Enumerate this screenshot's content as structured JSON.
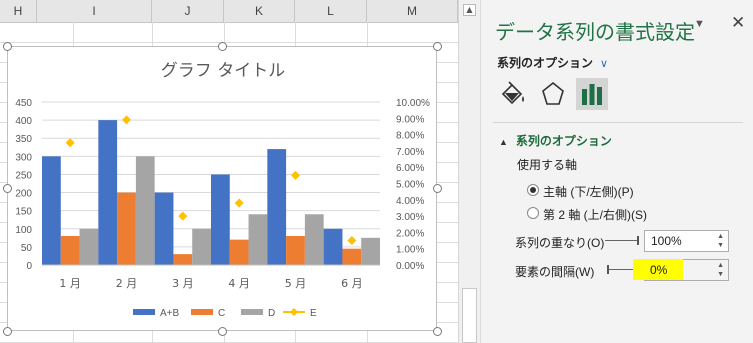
{
  "sheet": {
    "columns": [
      "H",
      "I",
      "J",
      "K",
      "L",
      "M"
    ]
  },
  "chart_data": {
    "type": "bar",
    "title": "グラフ タイトル",
    "categories": [
      "1 月",
      "2 月",
      "3 月",
      "4 月",
      "5 月",
      "6 月"
    ],
    "series": [
      {
        "name": "A+B",
        "type": "bar",
        "axis": "primary",
        "color": "#4472c4",
        "values": [
          300,
          400,
          200,
          250,
          320,
          100
        ]
      },
      {
        "name": "C",
        "type": "bar",
        "axis": "primary",
        "color": "#ed7d31",
        "values": [
          80,
          200,
          30,
          70,
          80,
          45
        ]
      },
      {
        "name": "D",
        "type": "bar",
        "axis": "primary",
        "color": "#a5a5a5",
        "values": [
          100,
          300,
          100,
          140,
          140,
          75
        ]
      },
      {
        "name": "E",
        "type": "scatter-marker",
        "axis": "secondary",
        "color": "#ffc000",
        "values": [
          0.075,
          0.089,
          0.03,
          0.038,
          0.055,
          0.015
        ]
      }
    ],
    "primary_ticks": [
      "0",
      "50",
      "100",
      "150",
      "200",
      "250",
      "300",
      "350",
      "400",
      "450"
    ],
    "secondary_ticks": [
      "0.00%",
      "1.00%",
      "2.00%",
      "3.00%",
      "4.00%",
      "5.00%",
      "6.00%",
      "7.00%",
      "8.00%",
      "9.00%",
      "10.00%"
    ],
    "ylim": [
      0,
      450
    ],
    "y2lim": [
      0,
      0.1
    ],
    "grid": true,
    "legend": "bottom"
  },
  "pane": {
    "title": "データ系列の書式設定",
    "title_chevron": "▼",
    "close": "✕",
    "options_label": "系列のオプション",
    "options_chevron": "∨",
    "tabs": [
      "fill-line",
      "effects",
      "series-options"
    ],
    "section_toggle": "▲",
    "section_title": "系列のオプション",
    "axis_label": "使用する軸",
    "radio_primary": "主軸 (下/左側)(P)",
    "radio_secondary": "第 2 軸 (上/右側)(S)",
    "overlap_label": "系列の重なり(O)",
    "overlap_value": "100%",
    "gap_label": "要素の間隔(W)",
    "gap_value": "0%",
    "spin_arrows": "▲▼",
    "highlight_color": "#ffff00"
  }
}
